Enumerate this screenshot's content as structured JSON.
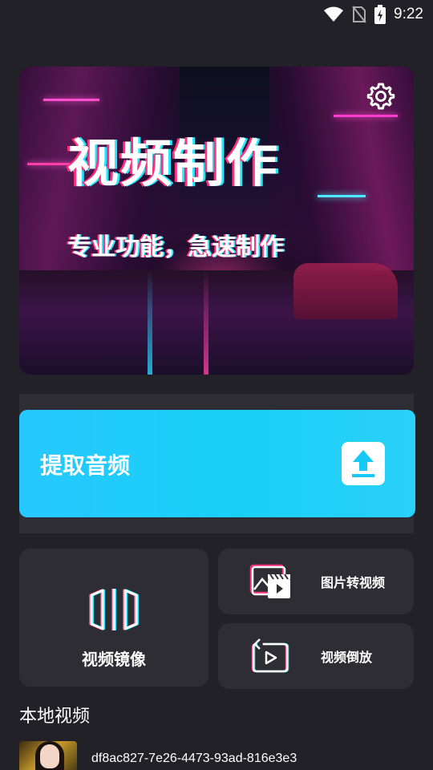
{
  "status_bar": {
    "time": "9:22",
    "icons": [
      "wifi-icon",
      "no-sim-icon",
      "battery-charging-icon"
    ]
  },
  "hero": {
    "title": "视频制作",
    "subtitle": "专业功能，急速制作",
    "settings_icon": "gear-icon"
  },
  "extract_audio": {
    "label": "提取音频",
    "icon": "upload-icon",
    "color": "#27c8ff"
  },
  "tools": {
    "mirror": {
      "label": "视频镜像",
      "icon": "mirror-icon"
    },
    "image_to_video": {
      "label": "图片转视频",
      "icon": "image-clapper-icon"
    },
    "reverse": {
      "label": "视频倒放",
      "icon": "reverse-play-icon"
    }
  },
  "local_videos": {
    "title": "本地视频",
    "items": [
      {
        "name": "df8ac827-7e26-4473-93ad-816e3e3"
      }
    ]
  },
  "colors": {
    "background": "#222127",
    "card": "#2e2d33",
    "accent_pink": "#ff2f7a",
    "accent_cyan": "#22e8ff"
  }
}
